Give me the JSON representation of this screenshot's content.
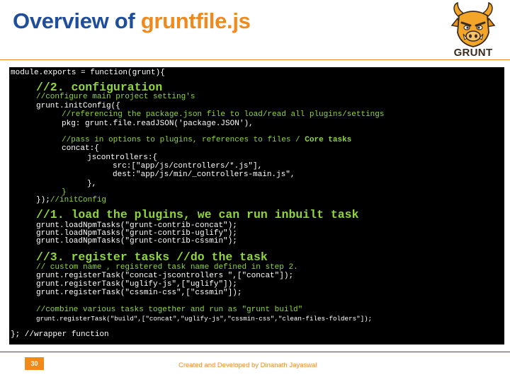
{
  "slide": {
    "title_prefix": "Overview of ",
    "title_highlight": "gruntfile.js",
    "logo_text": "GRUNT",
    "page_number": "30",
    "footer_credit": "Created and Developed by Dinanath Jayaswal"
  },
  "code": {
    "l01": "module.exports = function(grunt){",
    "l02": "//2. configuration",
    "l03": "//configure main project setting's",
    "l04": "grunt.initConfig({",
    "l05": "//referencing the package.json file to load/read all plugins/settings",
    "l06": "pkg: grunt.file.readJSON('package.JSON'),",
    "l07a": "//pass in options to plugins, references to files / ",
    "l07b": "Core tasks",
    "l08": "concat:{",
    "l09": "jscontrollers:{",
    "l10": "src:[\"app/js/controllers/*.js\"],",
    "l11": "dest:\"app/js/min/_controllers-main.js\",",
    "l12": "},",
    "l13": "}",
    "l14a": "});",
    "l14b": "//initConfig",
    "l15": "//1. load the plugins, we can run inbuilt task",
    "l16": "grunt.loadNpmTasks(\"grunt-contrib-concat\");",
    "l17": "grunt.loadNpmTasks(\"grunt-contrib-uglify\");",
    "l18": "grunt.loadNpmTasks(\"grunt-contrib-cssmin\");",
    "l19": "//3. register tasks //do the task",
    "l20": "// custom name , registered task name defined in step 2.",
    "l21": "grunt.registerTask(\"concat-jscontrollers \",[\"concat\"]);",
    "l22": "grunt.registerTask(\"uglify-js\",[\"uglify\"]);",
    "l23": "grunt.registerTask(\"cssmin-css\",[\"cssmin\"]);",
    "l24": "//combine various tasks together and run as \"grunt build\"",
    "l25": "grunt.registerTask(\"build\",[\"concat\",\"uglify-js\",\"cssmin-css\",\"clean-files-folders\"]);",
    "l26": "}; //wrapper function"
  },
  "colors": {
    "title_blue": "#1f4e9c",
    "accent_orange": "#f08a1c",
    "code_background": "#000000",
    "code_comment_green": "#8fd63a",
    "code_text_white": "#ffffff"
  }
}
